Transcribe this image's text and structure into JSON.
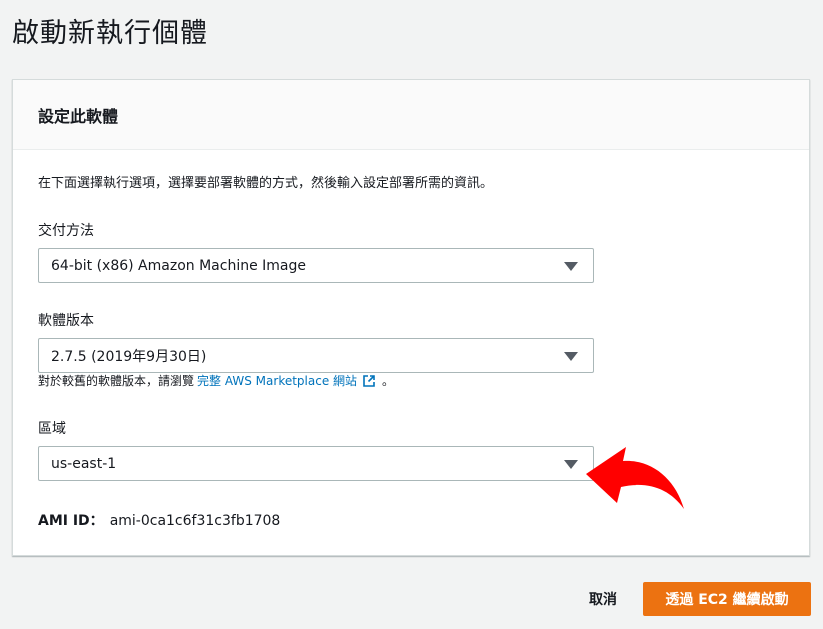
{
  "page": {
    "title": "啟動新執行個體"
  },
  "panel": {
    "title": "設定此軟體",
    "description": "在下面選擇執行選項，選擇要部署軟體的方式，然後輸入設定部署所需的資訊。"
  },
  "fields": {
    "delivery_method": {
      "label": "交付方法",
      "value": "64-bit (x86) Amazon Machine Image"
    },
    "software_version": {
      "label": "軟體版本",
      "value": "2.7.5 (2019年9月30日)"
    },
    "region": {
      "label": "區域",
      "value": "us-east-1"
    }
  },
  "hint": {
    "prefix": "對於較舊的軟體版本，請瀏覽",
    "link_text": "完整 AWS Marketplace 網站",
    "suffix": "。"
  },
  "ami": {
    "label": "AMI ID：",
    "value": "ami-0ca1c6f31c3fb1708"
  },
  "footer": {
    "cancel_label": "取消",
    "primary_label": "透過 EC2 繼續啟動"
  },
  "colors": {
    "primary_button": "#ec7211",
    "link": "#0073bb",
    "annotation_arrow": "#ff0000"
  },
  "icons": {
    "dropdown": "caret-down-icon",
    "external_link": "external-link-icon",
    "annotation": "curved-arrow-annotation"
  }
}
